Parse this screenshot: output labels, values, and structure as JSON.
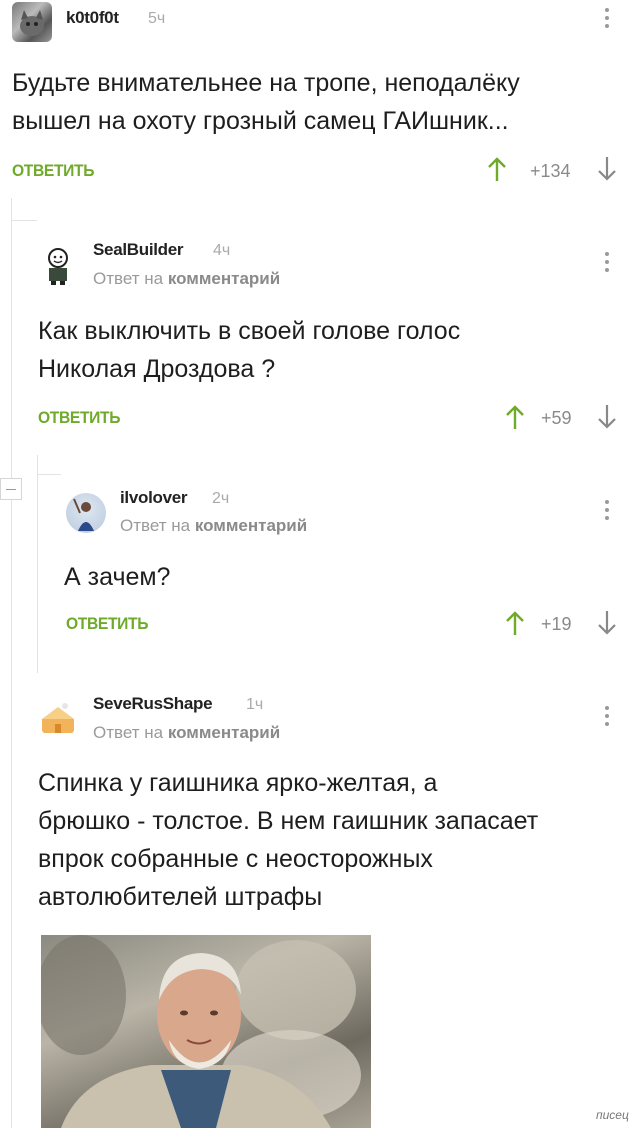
{
  "comments": [
    {
      "username": "k0t0f0t",
      "time": "5ч",
      "text_lines": [
        "Будьте внимательнее на тропе, неподалёку",
        "вышел на охоту грозный самец ГАИшник..."
      ],
      "reply_label": "ОТВЕТИТЬ",
      "score": "+134"
    },
    {
      "username": "SealBuilder",
      "time": "4ч",
      "reply_prefix": "Ответ на",
      "reply_target": "комментарий",
      "text_lines": [
        "Как выключить в своей голове голос",
        "Николая Дроздова ?"
      ],
      "reply_label": "ОТВЕТИТЬ",
      "score": "+59"
    },
    {
      "username": "ilvolover",
      "time": "2ч",
      "reply_prefix": "Ответ на",
      "reply_target": "комментарий",
      "text_lines": [
        "А зачем?"
      ],
      "reply_label": "ОТВЕТИТЬ",
      "score": "+19"
    },
    {
      "username": "SeveRusShape",
      "time": "1ч",
      "reply_prefix": "Ответ на",
      "reply_target": "комментарий",
      "text_lines": [
        "Спинка у гаишника ярко-желтая, а",
        "брюшко - толстое. В нем гаишник запасает",
        "впрок собранные с неосторожных",
        "автолюбителей штрафы"
      ]
    }
  ],
  "watermark": "писец",
  "colors": {
    "accent": "#6faa2a",
    "upvote": "#6faa2a",
    "downvote": "#888888"
  },
  "icons": {
    "upvote": "arrow-up-icon",
    "downvote": "arrow-down-icon",
    "menu": "kebab-menu-icon",
    "collapse": "collapse-minus-icon"
  }
}
